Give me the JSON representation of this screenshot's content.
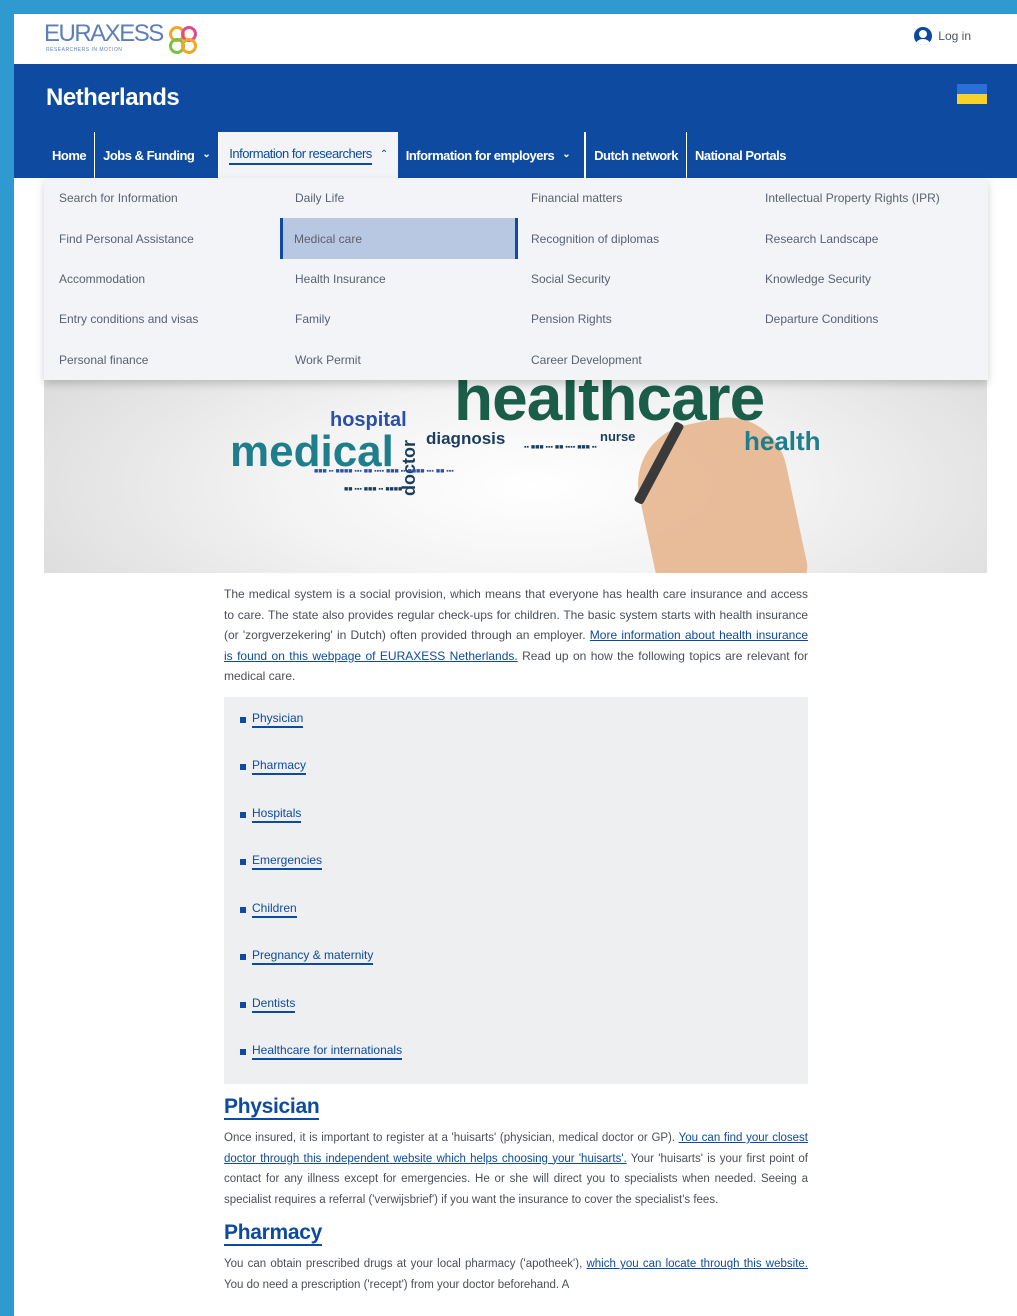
{
  "header": {
    "logo_text": "EURAXESS",
    "logo_subtext": "RESEARCHERS IN MOTION",
    "login_label": "Log in"
  },
  "banner": {
    "country": "Netherlands"
  },
  "nav": {
    "items": [
      {
        "label": "Home",
        "has_chevron": false
      },
      {
        "label": "Jobs & Funding",
        "has_chevron": true
      },
      {
        "label": "Information for researchers",
        "has_chevron": true,
        "active": true
      },
      {
        "label": "Information for employers",
        "has_chevron": true
      },
      {
        "label": "Dutch network",
        "has_chevron": false
      },
      {
        "label": "National Portals",
        "has_chevron": false
      }
    ]
  },
  "dropdown": {
    "columns": [
      [
        "Search for Information",
        "Find Personal Assistance",
        "Accommodation",
        "Entry conditions and visas",
        "Personal finance"
      ],
      [
        "Daily Life",
        "Medical care",
        "Health Insurance",
        "Family",
        "Work Permit"
      ],
      [
        "Financial matters",
        "Recognition of diplomas",
        "Social Security",
        "Pension Rights",
        "Career Development"
      ],
      [
        "Intellectual Property Rights (IPR)",
        "Research Landscape",
        "Knowledge Security",
        "Departure Conditions"
      ]
    ],
    "active_item": "Medical care"
  },
  "hero": {
    "words": {
      "healthcare": "healthcare",
      "medical": "medical",
      "hospital": "hospital",
      "diagnosis": "diagnosis",
      "doctor": "doctor",
      "health": "health",
      "nurse": "nurse"
    }
  },
  "content": {
    "intro_text": "The medical system is a social provision, which means that everyone has health care insurance and access to care. The state also provides regular check-ups for children. The basic system starts with health insurance (or 'zorgverzekering' in Dutch) often provided through an employer. ",
    "intro_link": "More information about health insurance is found on this webpage of EURAXESS Netherlands.",
    "intro_tail": " Read up on how the following topics are relevant for medical care.",
    "toc": [
      "Physician",
      "Pharmacy",
      "Hospitals",
      "Emergencies",
      "Children",
      "Pregnancy & maternity",
      "Dentists",
      "Healthcare for internationals"
    ],
    "sections": [
      {
        "title": "Physician",
        "text_before": "Once insured, it is important to register at a 'huisarts' (physician, medical doctor or GP). ",
        "link": "You can find your closest doctor through this independent website which helps choosing your 'huisarts'.",
        "text_after": " Your 'huisarts' is your first point of contact for any illness except for emergencies. He or she will direct you to specialists when needed. Seeing a specialist requires a referral ('verwijsbrief') if you want the insurance to cover the specialist's fees."
      },
      {
        "title": "Pharmacy",
        "text_before": "You can obtain prescribed drugs at your local pharmacy ('apotheek'), ",
        "link": "which you can locate through this website.",
        "text_after": " You do need a prescription ('recept') from your doctor beforehand. A"
      }
    ]
  },
  "colors": {
    "brand_blue": "#0e4ba0",
    "outer_background": "#2e9ad0",
    "dropdown_background": "#f2f4f8",
    "active_item_background": "#b9c8e2"
  }
}
